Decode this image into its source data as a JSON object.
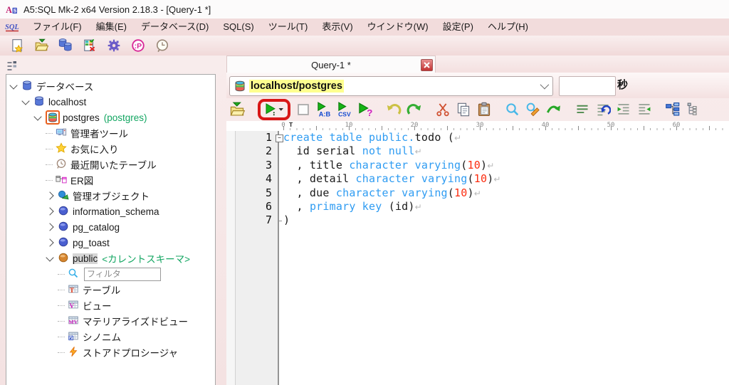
{
  "window": {
    "title": "A5:SQL Mk-2 x64 Version 2.18.3 - [Query-1 *]",
    "app_icon": "a5-logo-icon"
  },
  "menu": {
    "logo_icon": "sql-logo-icon",
    "items": [
      "ファイル(F)",
      "編集(E)",
      "データベース(D)",
      "SQL(S)",
      "ツール(T)",
      "表示(V)",
      "ウインドウ(W)",
      "設定(P)",
      "ヘルプ(H)"
    ]
  },
  "main_toolbar": {
    "buttons": [
      {
        "name": "new-document-button",
        "icon": "new-document-icon"
      },
      {
        "name": "open-file-button",
        "icon": "open-folder-icon"
      },
      {
        "name": "databases-button",
        "icon": "databases-icon"
      },
      {
        "name": "database-manage-button",
        "icon": "db-grid-icon"
      },
      {
        "name": "settings-button",
        "icon": "gear-icon"
      },
      {
        "name": "procedure-button",
        "icon": "procedure-icon"
      },
      {
        "name": "history-button",
        "icon": "history-icon"
      }
    ]
  },
  "tree_panel": {
    "toolbar_icon": "tree-options-icon",
    "items": [
      {
        "depth": 0,
        "expander": "open",
        "icon": "database-blue-icon",
        "label": "データベース"
      },
      {
        "depth": 1,
        "expander": "open",
        "icon": "database-blue-icon",
        "label": "localhost"
      },
      {
        "depth": 2,
        "expander": "open",
        "icon": "database-color-icon",
        "label": "postgres",
        "suffix": "(postgres)",
        "ring": true
      },
      {
        "depth": 3,
        "icon": "admin-tools-icon",
        "label": "管理者ツール"
      },
      {
        "depth": 3,
        "icon": "star-icon",
        "label": "お気に入り"
      },
      {
        "depth": 3,
        "icon": "clock-icon",
        "label": "最近開いたテーブル"
      },
      {
        "depth": 3,
        "icon": "er-diagram-icon",
        "label": "ER図"
      },
      {
        "depth": 3,
        "expander": "closed",
        "icon": "managed-objects-icon",
        "label": "管理オブジェクト"
      },
      {
        "depth": 3,
        "expander": "closed",
        "icon": "schema-icon",
        "label": "information_schema"
      },
      {
        "depth": 3,
        "expander": "closed",
        "icon": "schema-icon",
        "label": "pg_catalog"
      },
      {
        "depth": 3,
        "expander": "closed",
        "icon": "schema-icon",
        "label": "pg_toast"
      },
      {
        "depth": 3,
        "expander": "open",
        "icon": "schema-current-icon",
        "label": "public",
        "suffix": "<カレントスキーマ>",
        "selected": true
      },
      {
        "depth": 4,
        "type": "filter",
        "icon": "search-icon",
        "placeholder": "フィルタ"
      },
      {
        "depth": 4,
        "icon": "table-icon",
        "label": "テーブル"
      },
      {
        "depth": 4,
        "icon": "view-icon",
        "label": "ビュー"
      },
      {
        "depth": 4,
        "icon": "materialized-view-icon",
        "label": "マテリアライズドビュー"
      },
      {
        "depth": 4,
        "icon": "synonym-icon",
        "label": "シノニム"
      },
      {
        "depth": 4,
        "icon": "stored-procedure-icon",
        "label": "ストアドプロシージャ"
      }
    ]
  },
  "editor": {
    "tab_label": "Query-1 *",
    "close_icon": "close-icon",
    "connection_value": "localhost/postgres",
    "connection_icon": "database-color-icon",
    "timer_value": "",
    "timer_unit": "秒",
    "highlight_color": "#feff8f",
    "annotation_color": "#d81616",
    "sql_toolbar_groups": [
      [
        {
          "name": "open-sql-file-button",
          "icon": "open-sql-icon"
        }
      ],
      [
        {
          "name": "run-query-button",
          "icon": "run-icon",
          "annotated": true
        },
        {
          "name": "stop-query-button",
          "icon": "stop-icon"
        },
        {
          "name": "run-ab-button",
          "icon": "run-ab-icon"
        },
        {
          "name": "run-csv-button",
          "icon": "run-csv-icon"
        },
        {
          "name": "run-explain-button",
          "icon": "run-explain-icon"
        }
      ],
      [
        {
          "name": "undo-button",
          "icon": "undo-icon"
        },
        {
          "name": "redo-button",
          "icon": "redo-icon"
        }
      ],
      [
        {
          "name": "cut-button",
          "icon": "cut-icon"
        },
        {
          "name": "copy-button",
          "icon": "copy-icon"
        },
        {
          "name": "paste-button",
          "icon": "paste-icon"
        }
      ],
      [
        {
          "name": "find-button",
          "icon": "find-icon"
        },
        {
          "name": "replace-button",
          "icon": "replace-icon"
        },
        {
          "name": "resume-search-button",
          "icon": "resume-icon"
        }
      ],
      [
        {
          "name": "format-lines-button",
          "icon": "format-lines-icon"
        },
        {
          "name": "format-sql-button",
          "icon": "format-sql-icon"
        },
        {
          "name": "indent-button",
          "icon": "indent-icon"
        },
        {
          "name": "outdent-button",
          "icon": "outdent-icon"
        }
      ],
      [
        {
          "name": "structure-view-button",
          "icon": "structure-icon"
        },
        {
          "name": "outline-view-button",
          "icon": "outline-icon"
        }
      ]
    ],
    "ruler_numbers": [
      0,
      10,
      20,
      30,
      40,
      50,
      60
    ],
    "ruler_tab_marker": "T",
    "code": {
      "keyword_color": "#2f9cf2",
      "number_color": "#fb2d10",
      "lines": [
        {
          "no": "1",
          "fold": true,
          "eol": true,
          "segments": [
            {
              "c": "kw",
              "t": "create table public."
            },
            {
              "c": "plain",
              "t": "todo ("
            }
          ]
        },
        {
          "no": "2",
          "eol": true,
          "segments": [
            {
              "c": "plain",
              "t": "  id serial "
            },
            {
              "c": "kw",
              "t": "not null"
            }
          ]
        },
        {
          "no": "3",
          "eol": true,
          "segments": [
            {
              "c": "plain",
              "t": "  , title "
            },
            {
              "c": "kw",
              "t": "character varying"
            },
            {
              "c": "plain",
              "t": "("
            },
            {
              "c": "num",
              "t": "10"
            },
            {
              "c": "plain",
              "t": ")"
            }
          ]
        },
        {
          "no": "4",
          "eol": true,
          "segments": [
            {
              "c": "plain",
              "t": "  , detail "
            },
            {
              "c": "kw",
              "t": "character varying"
            },
            {
              "c": "plain",
              "t": "("
            },
            {
              "c": "num",
              "t": "10"
            },
            {
              "c": "plain",
              "t": ")"
            }
          ]
        },
        {
          "no": "5",
          "eol": true,
          "segments": [
            {
              "c": "plain",
              "t": "  , due "
            },
            {
              "c": "kw",
              "t": "character varying"
            },
            {
              "c": "plain",
              "t": "("
            },
            {
              "c": "num",
              "t": "10"
            },
            {
              "c": "plain",
              "t": ")"
            }
          ]
        },
        {
          "no": "6",
          "eol": true,
          "segments": [
            {
              "c": "plain",
              "t": "  , "
            },
            {
              "c": "kw",
              "t": "primary key"
            },
            {
              "c": "plain",
              "t": " (id)"
            }
          ]
        },
        {
          "no": "7",
          "eol": false,
          "segments": [
            {
              "c": "plain",
              "t": ")"
            }
          ]
        }
      ]
    }
  }
}
